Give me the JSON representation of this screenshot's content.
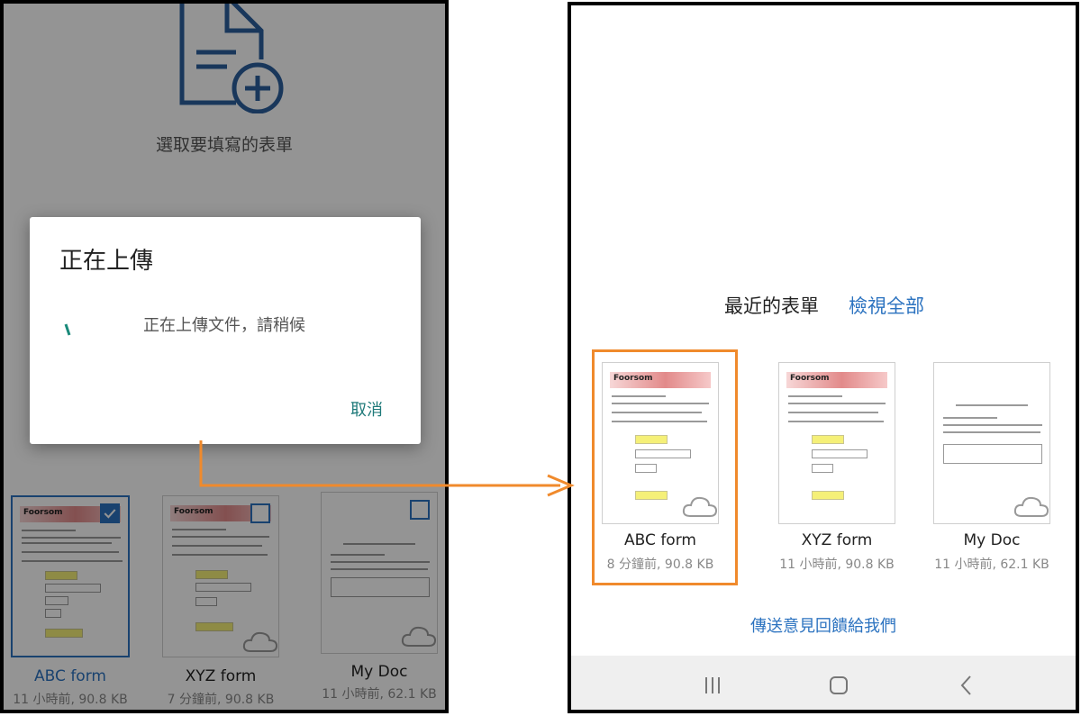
{
  "left_screen": {
    "prompt": "選取要填寫的表單",
    "dialog": {
      "title": "正在上傳",
      "message": "正在上傳文件，請稍候",
      "cancel_label": "取消"
    },
    "cards": [
      {
        "name": "ABC form",
        "meta": "11 小時前, 90.8 KB",
        "checked": true
      },
      {
        "name": "XYZ form",
        "meta": "7 分鐘前, 90.8 KB",
        "checked": false
      },
      {
        "name": "My Doc",
        "meta": "11 小時前, 62.1 KB",
        "checked": false
      }
    ]
  },
  "right_screen": {
    "recent_title": "最近的表單",
    "view_all_label": "檢視全部",
    "cards": [
      {
        "name": "ABC form",
        "meta": "8 分鐘前, 90.8 KB"
      },
      {
        "name": "XYZ form",
        "meta": "11 小時前, 90.8 KB"
      },
      {
        "name": "My Doc",
        "meta": "11 小時前, 62.1 KB"
      }
    ],
    "feedback_label": "傳送意見回饋給我們",
    "nav": [
      "recent-apps-icon",
      "home-icon",
      "back-icon"
    ]
  },
  "thumb_logo_text": "Foorsom",
  "colors": {
    "accent_blue": "#2c73c0",
    "highlight_orange": "#f08a2c",
    "teal": "#1f7a7a"
  }
}
